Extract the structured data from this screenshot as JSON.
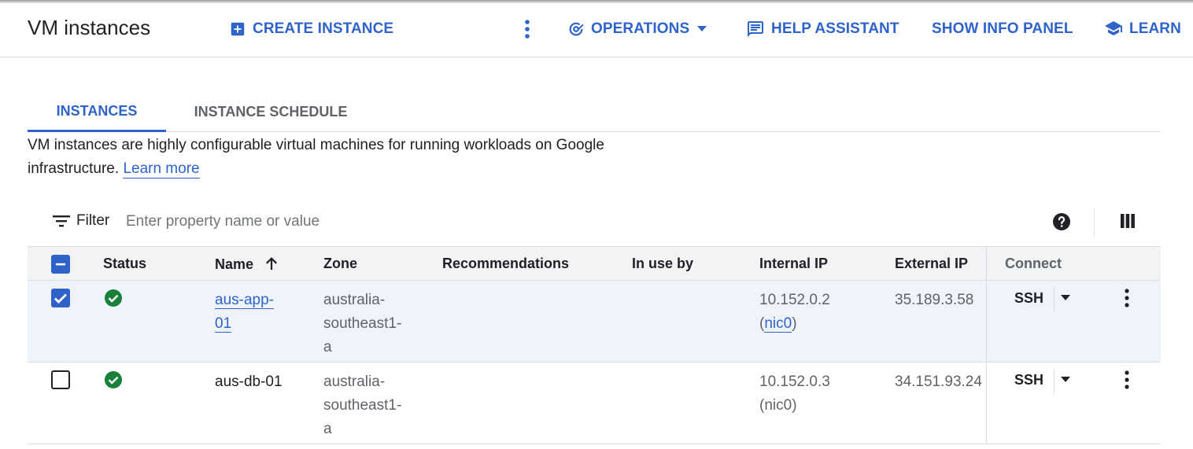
{
  "header": {
    "title": "VM instances",
    "create_label": "CREATE INSTANCE",
    "operations_label": "OPERATIONS",
    "help_label": "HELP ASSISTANT",
    "info_label": "SHOW INFO PANEL",
    "learn_label": "LEARN"
  },
  "tabs": [
    {
      "label": "INSTANCES",
      "active": true
    },
    {
      "label": "INSTANCE SCHEDULE",
      "active": false
    }
  ],
  "description": {
    "text": "VM instances are highly configurable virtual machines for running workloads on Google infrastructure.",
    "link": "Learn more"
  },
  "filter": {
    "label": "Filter",
    "placeholder": "Enter property name or value"
  },
  "table": {
    "columns": [
      "Status",
      "Name",
      "Zone",
      "Recommendations",
      "In use by",
      "Internal IP",
      "External IP",
      "Connect"
    ],
    "sort_column": "Name",
    "rows": [
      {
        "selected": true,
        "status": "running",
        "name_line1": "aus-app-",
        "name_line2": "01",
        "zone_line1": "australia-",
        "zone_line2": "southeast1-",
        "zone_line3": "a",
        "recommendations": "",
        "in_use_by": "",
        "internal_ip": "10.152.0.2",
        "nic": "nic0",
        "external_ip": "35.189.3.58",
        "connect": "SSH"
      },
      {
        "selected": false,
        "status": "running",
        "name_line1": "aus-db-01",
        "name_line2": "",
        "zone_line1": "australia-",
        "zone_line2": "southeast1-",
        "zone_line3": "a",
        "recommendations": "",
        "in_use_by": "",
        "internal_ip": "10.152.0.3",
        "nic": "nic0",
        "external_ip": "34.151.93.24",
        "connect": "SSH"
      }
    ]
  },
  "colors": {
    "accent": "#2f63c9",
    "status_green": "#188038",
    "selected_row": "#eef3fc",
    "header_bg": "#f1f3f4"
  }
}
